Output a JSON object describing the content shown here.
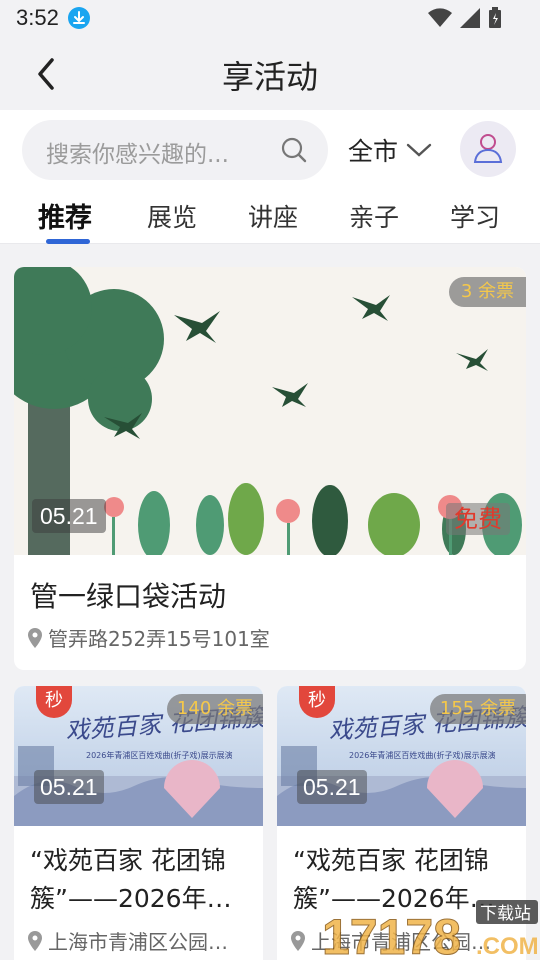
{
  "status_bar": {
    "time": "3:52"
  },
  "header": {
    "title": "享活动"
  },
  "search": {
    "placeholder": "搜索你感兴趣的..."
  },
  "city": {
    "label": "全市"
  },
  "tabs": [
    {
      "label": "推荐",
      "active": true
    },
    {
      "label": "展览",
      "active": false
    },
    {
      "label": "讲座",
      "active": false
    },
    {
      "label": "亲子",
      "active": false
    },
    {
      "label": "学习",
      "active": false
    }
  ],
  "featured": {
    "title": "管一绿口袋活动",
    "location": "管弄路252弄15号101室",
    "date": "05.21",
    "tickets": "3 余票",
    "price": "免费"
  },
  "events": [
    {
      "sec_label": "秒",
      "tickets": "140 余票",
      "date": "05.21",
      "title": "“戏苑百家 花团锦簇”——2026年…",
      "location": "上海市青浦区公园…"
    },
    {
      "sec_label": "秒",
      "tickets": "155 余票",
      "date": "05.21",
      "title": "“戏苑百家 花团锦簇”——2026年…",
      "location": "上海市青浦区公园…"
    }
  ],
  "poster": {
    "headline": "戏苑百家 花团锦簇",
    "subline": "2026年青浦区百姓戏曲(折子戏)展示展演"
  },
  "watermark": {
    "number": "17178",
    "domain": ".COM",
    "site": "下载站"
  },
  "colors": {
    "accent": "#2f66d6",
    "ticket": "#f5c84a",
    "free": "#e03a2c",
    "sec": "#e2473c"
  }
}
